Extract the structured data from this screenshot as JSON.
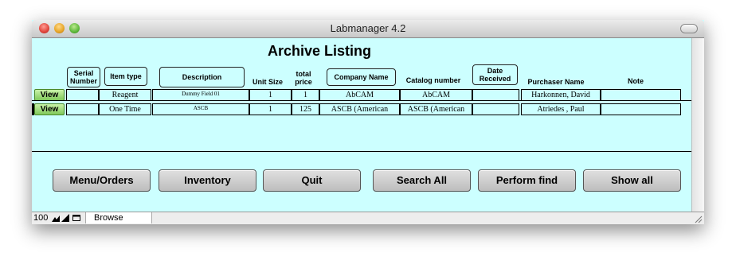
{
  "window": {
    "title": "Labmanager 4.2"
  },
  "report": {
    "title": "Archive Listing"
  },
  "headers": {
    "serial": "Serial Number",
    "item_type": "Item type",
    "description": "Description",
    "unit_size": "Unit Size",
    "total_price": "total price",
    "company": "Company Name",
    "catalog": "Catalog number",
    "date_received": "Date Received",
    "purchaser": "Purchaser Name",
    "note": "Note"
  },
  "rows": [
    {
      "view_label": "View",
      "serial": "",
      "item_type": "Reagent",
      "description": "Dummy Field 01",
      "unit_size": "1",
      "total_price": "1",
      "company": "AbCAM",
      "catalog": "AbCAM",
      "date_received": "",
      "purchaser": "Harkonnen, David",
      "note": ""
    },
    {
      "view_label": "View",
      "serial": "",
      "item_type": "One Time",
      "description": "ASCB",
      "unit_size": "1",
      "total_price": "125",
      "company": "ASCB (American",
      "catalog": "ASCB (American",
      "date_received": "",
      "purchaser": "Atriedes , Paul",
      "note": ""
    }
  ],
  "buttons": {
    "menu_orders": "Menu/Orders",
    "inventory": "Inventory",
    "quit": "Quit",
    "search_all": "Search All",
    "perform_find": "Perform find",
    "show_all": "Show all"
  },
  "status": {
    "zoom": "100",
    "mode": "Browse"
  },
  "colors": {
    "background": "#ccffff",
    "view_button": "#80c85a"
  }
}
